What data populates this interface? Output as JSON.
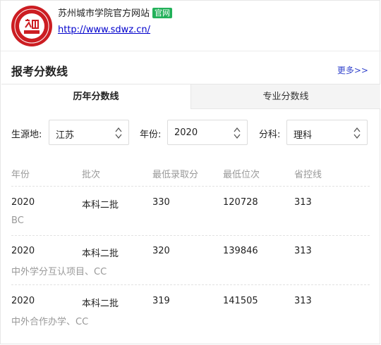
{
  "header": {
    "logo_icon": "university-seal-icon",
    "site_name": "苏州城市学院官方网站",
    "badge": "官网",
    "url": "http://www.sdwz.cn/"
  },
  "section": {
    "title": "报考分数线",
    "more": "更多>>"
  },
  "tabs": [
    {
      "label": "历年分数线",
      "active": true
    },
    {
      "label": "专业分数线",
      "active": false
    }
  ],
  "filters": {
    "province": {
      "label": "生源地:",
      "value": "江苏"
    },
    "year": {
      "label": "年份:",
      "value": "2020"
    },
    "subject": {
      "label": "分科:",
      "value": "理科"
    }
  },
  "table": {
    "columns": [
      "年份",
      "批次",
      "最低录取分",
      "最低位次",
      "省控线"
    ],
    "rows": [
      {
        "year": "2020",
        "batch": "本科二批",
        "min_score": "330",
        "min_rank": "120728",
        "control_line": "313",
        "note": "BC"
      },
      {
        "year": "2020",
        "batch": "本科二批",
        "min_score": "320",
        "min_rank": "139846",
        "control_line": "313",
        "note": "中外学分互认项目、CC"
      },
      {
        "year": "2020",
        "batch": "本科二批",
        "min_score": "319",
        "min_rank": "141505",
        "control_line": "313",
        "note": "中外合作办学、CC"
      }
    ]
  },
  "colors": {
    "badge": "#23b15a",
    "link": "#0000cc",
    "seal": "#cc1d22"
  }
}
